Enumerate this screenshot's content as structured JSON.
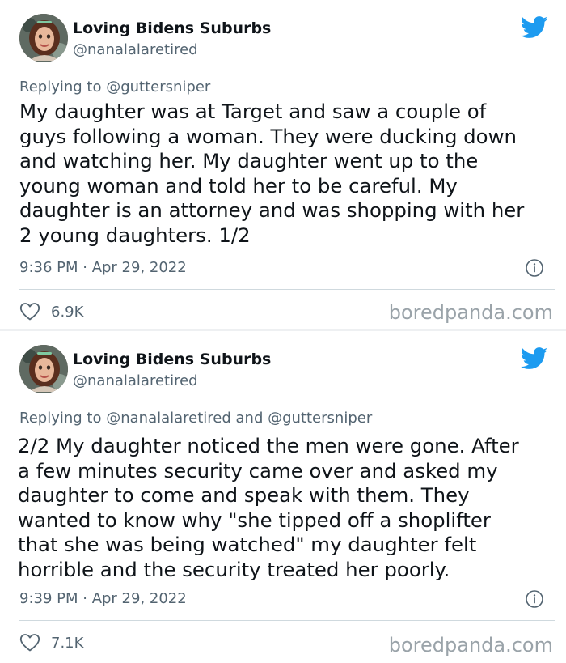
{
  "brand_color": "#1d9bf0",
  "tweets": [
    {
      "display_name": "Loving Bidens Suburbs",
      "handle": "@nanalalaretired",
      "reply_prefix": "Replying to",
      "reply_mentions": "@guttersniper",
      "text": "My daughter was at Target and saw a couple of\nguys following a woman. They were ducking down\nand watching her. My daughter went up to the\nyoung woman and told her to be careful. My\ndaughter is an attorney and was shopping with her\n2 young daughters. 1/2",
      "timestamp": "9:36 PM · Apr 29, 2022",
      "likes": "6.9K",
      "watermark": "boredpanda.com",
      "icons": [
        "avatar",
        "twitter-bird-icon",
        "info-icon",
        "heart-icon"
      ]
    },
    {
      "display_name": "Loving Bidens Suburbs",
      "handle": "@nanalalaretired",
      "reply_prefix": "Replying to",
      "reply_mentions": "@nanalalaretired and @guttersniper",
      "text": "2/2 My daughter noticed the men were gone. After\na few minutes security came over and asked my\ndaughter to come and speak with them. They\nwanted to know why \"she tipped off a shoplifter\nthat she was being watched\" my daughter felt\nhorrible and the security treated her poorly.",
      "timestamp": "9:39 PM · Apr 29, 2022",
      "likes": "7.1K",
      "watermark": "boredpanda.com",
      "icons": [
        "avatar",
        "twitter-bird-icon",
        "info-icon",
        "heart-icon"
      ]
    }
  ]
}
